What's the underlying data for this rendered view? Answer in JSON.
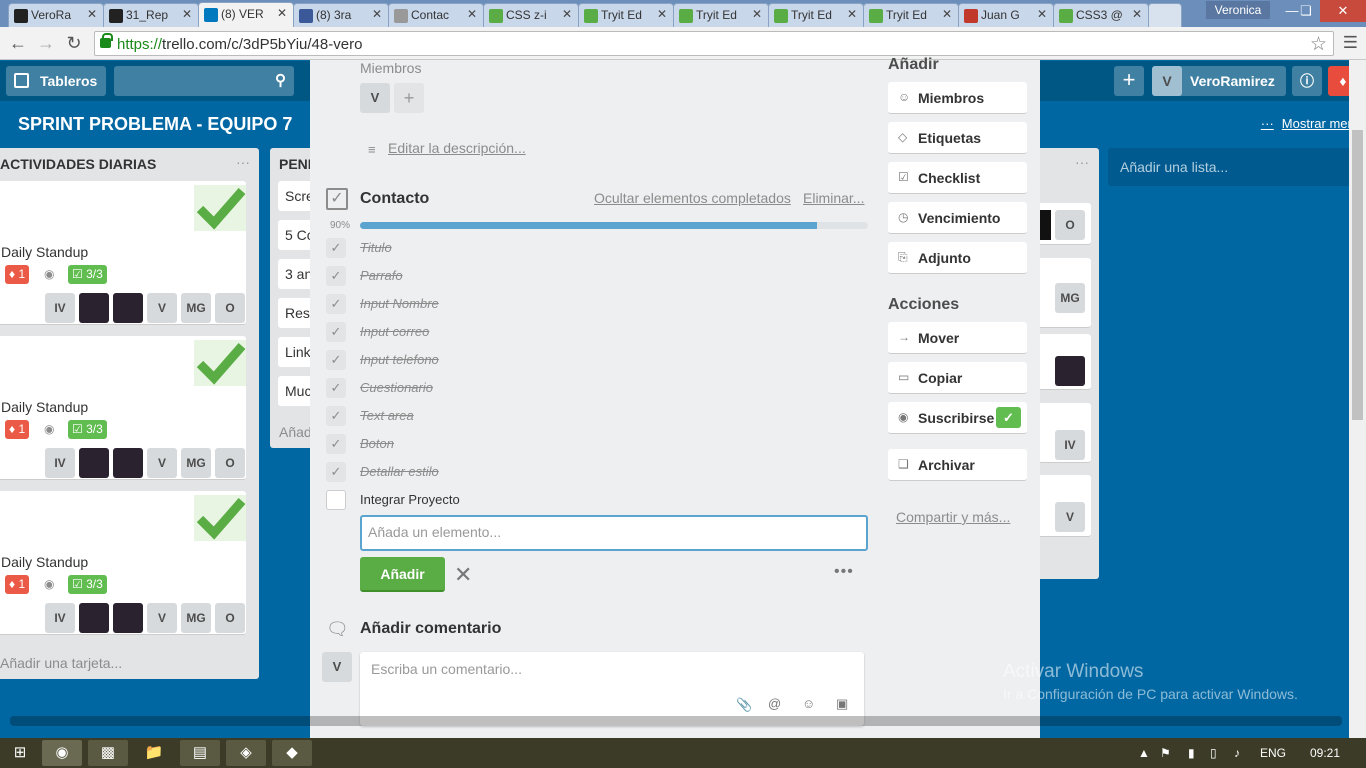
{
  "browser": {
    "tabs": [
      {
        "title": "VeroRa",
        "color": "#222"
      },
      {
        "title": "31_Rep",
        "color": "#222"
      },
      {
        "title": "(8) VER",
        "color": "#0079bf"
      },
      {
        "title": "(8) 3ra",
        "color": "#3b5998"
      },
      {
        "title": "Contac",
        "color": "#999"
      },
      {
        "title": "CSS z-i",
        "color": "#5aac44"
      },
      {
        "title": "Tryit Ed",
        "color": "#5aac44"
      },
      {
        "title": "Tryit Ed",
        "color": "#5aac44"
      },
      {
        "title": "Tryit Ed",
        "color": "#5aac44"
      },
      {
        "title": "Tryit Ed",
        "color": "#5aac44"
      },
      {
        "title": "Juan G",
        "color": "#c0392b"
      },
      {
        "title": "CSS3 @",
        "color": "#5aac44"
      }
    ],
    "user": "Veronica",
    "url_secure": "https://",
    "url_rest": "trello.com/c/3dP5bYiu/48-vero"
  },
  "header": {
    "boards": "Tableros",
    "user_initial": "V",
    "username": "VeroRamirez"
  },
  "board": {
    "title": "SPRINT PROBLEMA - EQUIPO 7",
    "show_menu": "Mostrar menú",
    "add_list": "Añadir una lista..."
  },
  "list1": {
    "title": "ACTIVIDADES DIARIAS",
    "card_title": "Daily Standup",
    "alert_count": "1",
    "checklist": "3/3",
    "members": [
      "IV",
      "",
      "",
      "V",
      "MG",
      "O"
    ],
    "add_card": "Añadir una tarjeta..."
  },
  "list2": {
    "title": "PEND",
    "cards": [
      "Scre",
      "5 Co",
      "3 an",
      "Res",
      "Link",
      "Muc"
    ],
    "add": "Añad"
  },
  "right_cards": {
    "o": "O",
    "mg": "MG",
    "iv": "IV",
    "v": "V"
  },
  "modal": {
    "members_label": "Miembros",
    "member_initial": "V",
    "add_member": "+",
    "edit_description": "Editar la descripción...",
    "checklist_title": "Contacto",
    "hide_completed": "Ocultar elementos completados",
    "delete": "Eliminar...",
    "progress_label": "90%",
    "progress_fraction": 0.9,
    "items": [
      {
        "text": "Titulo",
        "done": true
      },
      {
        "text": "Parrafo",
        "done": true
      },
      {
        "text": "Input Nombre",
        "done": true
      },
      {
        "text": "Input correo",
        "done": true
      },
      {
        "text": "Input telefono",
        "done": true
      },
      {
        "text": "Cuestionario",
        "done": true
      },
      {
        "text": "Text area",
        "done": true
      },
      {
        "text": "Boton",
        "done": true
      },
      {
        "text": "Detallar estilo",
        "done": true
      },
      {
        "text": "Integrar Proyecto",
        "done": false
      }
    ],
    "add_item_placeholder": "Añada un elemento...",
    "add_button": "Añadir",
    "add_comment_title": "Añadir comentario",
    "comment_placeholder": "Escriba un comentario...",
    "commenter_initial": "V"
  },
  "sidebar": {
    "add_title": "Añadir",
    "add_buttons": [
      "Miembros",
      "Etiquetas",
      "Checklist",
      "Vencimiento",
      "Adjunto"
    ],
    "actions_title": "Acciones",
    "action_buttons": [
      "Mover",
      "Copiar",
      "Suscribirse",
      "Archivar"
    ],
    "share": "Compartir y más..."
  },
  "watermark": {
    "line1": "Activar Windows",
    "line2": "Ir a Configuración de PC para activar Windows."
  },
  "taskbar": {
    "lang": "ENG",
    "time": "09:21"
  }
}
